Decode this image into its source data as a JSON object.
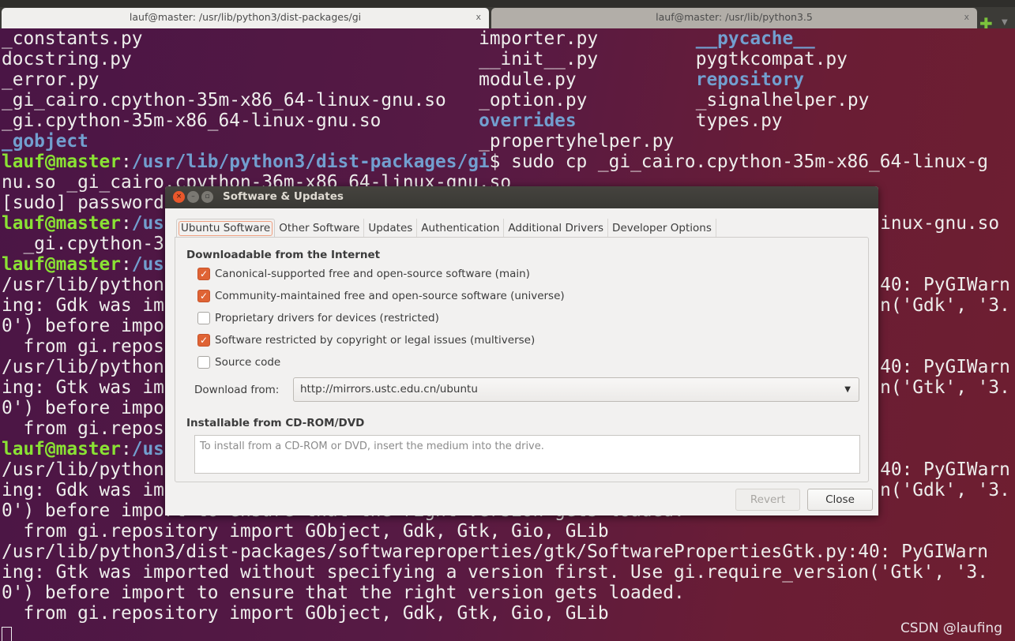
{
  "terminal_tabs": [
    {
      "title": "lauf@master: /usr/lib/python3/dist-packages/gi",
      "close": "x",
      "active": true
    },
    {
      "title": "lauf@master: /usr/lib/python3.5",
      "close": "x",
      "active": false
    }
  ],
  "new_tab_icon": "plus-icon",
  "terminal": {
    "listing": [
      [
        "_constants.py",
        "importer.py",
        "__pycache__"
      ],
      [
        "docstring.py",
        "__init__.py",
        "pygtkcompat.py"
      ],
      [
        "_error.py",
        "module.py",
        "repository"
      ],
      [
        "_gi_cairo.cpython-35m-x86_64-linux-gnu.so",
        "_option.py",
        "_signalhelper.py"
      ],
      [
        "_gi.cpython-35m-x86_64-linux-gnu.so",
        "overrides",
        "types.py"
      ],
      [
        "_gobject",
        "_propertyhelper.py",
        ""
      ]
    ],
    "prompt_user": "lauf@master",
    "prompt_path": "/usr/lib/python3/dist-packages/gi",
    "prompt_path_partial": "/us",
    "cmd1": "$ sudo cp _gi_cairo.cpython-35m-x86_64-linux-g",
    "l7": "nu.so _gi_cairo.cpython-36m-x86_64-linux-gnu.so",
    "l8": "[sudo] password",
    "l9r": "inux-gnu.so",
    "l10": "  _gi.cpython-36",
    "w1": "/usr/lib/python",
    "w1r": "40: PyGIWarn",
    "w2gdk": "ing: Gdk was im",
    "w2gdkr": "n('Gdk', '3.",
    "w2gtk": "ing: Gtk was im",
    "w2gtkr": "n('Gtk', '3.",
    "w3": "0') before impo",
    "w4": "  from gi.repos",
    "l23": "0') before import to ensure that the right version gets loaded.",
    "l24": "  from gi.repository import GObject, Gdk, Gtk, Gio, GLib",
    "l25": "/usr/lib/python3/dist-packages/softwareproperties/gtk/SoftwarePropertiesGtk.py:40: PyGIWarn",
    "l26": "ing: Gtk was imported without specifying a version first. Use gi.require_version('Gtk', '3.",
    "l27": "0') before import to ensure that the right version gets loaded.",
    "l28": "  from gi.repository import GObject, Gdk, Gtk, Gio, GLib"
  },
  "watermark": "CSDN @laufing",
  "dialog": {
    "title": "Software & Updates",
    "tabs": [
      "Ubuntu Software",
      "Other Software",
      "Updates",
      "Authentication",
      "Additional Drivers",
      "Developer Options"
    ],
    "section1": "Downloadable from the Internet",
    "options": [
      {
        "label": "Canonical-supported free and open-source software (main)",
        "checked": true
      },
      {
        "label": "Community-maintained free and open-source software (universe)",
        "checked": true
      },
      {
        "label": "Proprietary drivers for devices (restricted)",
        "checked": false
      },
      {
        "label": "Software restricted by copyright or legal issues (multiverse)",
        "checked": true
      },
      {
        "label": "Source code",
        "checked": false
      }
    ],
    "download_label": "Download from:",
    "download_value": "http://mirrors.ustc.edu.cn/ubuntu",
    "section2": "Installable from CD-ROM/DVD",
    "cd_text": "To install from a CD-ROM or DVD, insert the medium into the drive.",
    "revert": "Revert",
    "close": "Close"
  },
  "colors": {
    "accent": "#df6334",
    "prompt_green": "#8ae234",
    "dir_blue": "#729fcf"
  }
}
